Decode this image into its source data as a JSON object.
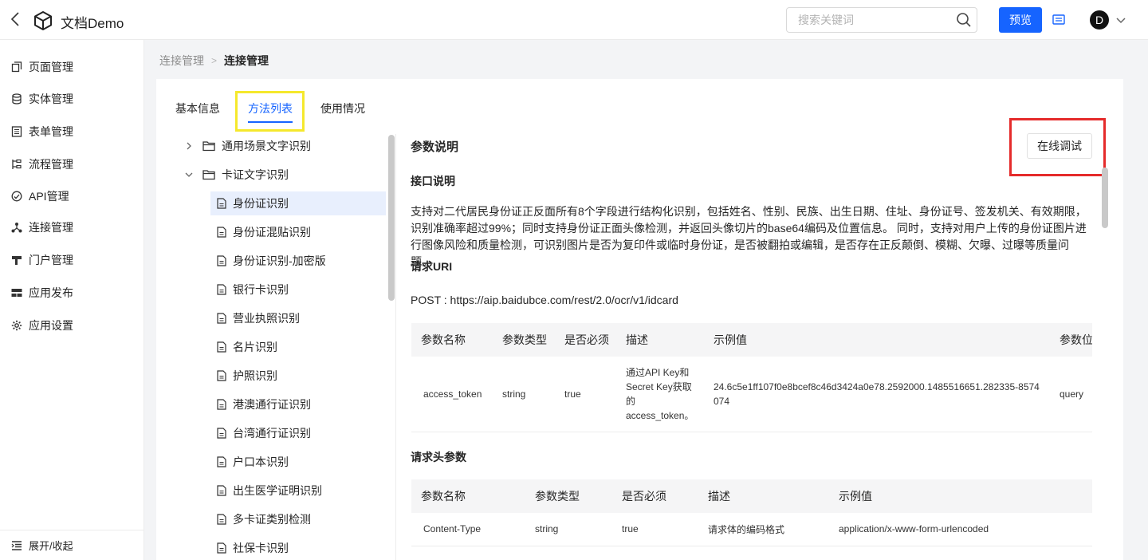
{
  "header": {
    "app_title": "文档Demo",
    "search_placeholder": "搜索关键词",
    "preview_label": "预览",
    "avatar_initial": "D"
  },
  "sidebar": {
    "items": [
      {
        "label": "页面管理",
        "icon": "pages-icon"
      },
      {
        "label": "实体管理",
        "icon": "database-icon"
      },
      {
        "label": "表单管理",
        "icon": "form-icon"
      },
      {
        "label": "流程管理",
        "icon": "flow-icon"
      },
      {
        "label": "API管理",
        "icon": "api-icon"
      },
      {
        "label": "连接管理",
        "icon": "connection-icon"
      },
      {
        "label": "门户管理",
        "icon": "portal-icon"
      },
      {
        "label": "应用发布",
        "icon": "publish-icon"
      },
      {
        "label": "应用设置",
        "icon": "gear-icon"
      }
    ],
    "footer_label": "展开/收起"
  },
  "breadcrumb": {
    "parent": "连接管理",
    "separator": ">",
    "current": "连接管理"
  },
  "tabs": [
    {
      "label": "基本信息",
      "active": false
    },
    {
      "label": "方法列表",
      "active": true
    },
    {
      "label": "使用情况",
      "active": false
    }
  ],
  "tree": {
    "folders": [
      {
        "label": "通用场景文字识别",
        "expanded": false
      },
      {
        "label": "卡证文字识别",
        "expanded": true
      }
    ],
    "items": [
      {
        "label": "身份证识别",
        "selected": true
      },
      {
        "label": "身份证混贴识别",
        "selected": false
      },
      {
        "label": "身份证识别-加密版",
        "selected": false
      },
      {
        "label": "银行卡识别",
        "selected": false
      },
      {
        "label": "营业执照识别",
        "selected": false
      },
      {
        "label": "名片识别",
        "selected": false
      },
      {
        "label": "护照识别",
        "selected": false
      },
      {
        "label": "港澳通行证识别",
        "selected": false
      },
      {
        "label": "台湾通行证识别",
        "selected": false
      },
      {
        "label": "户口本识别",
        "selected": false
      },
      {
        "label": "出生医学证明识别",
        "selected": false
      },
      {
        "label": "多卡证类别检测",
        "selected": false
      },
      {
        "label": "社保卡识别",
        "selected": false
      }
    ]
  },
  "doc": {
    "title": "参数说明",
    "debug_button": "在线调试",
    "interface_heading": "接口说明",
    "description_line1": "支持对二代居民身份证正反面所有8个字段进行结构化识别，包括姓名、性别、民族、出生日期、住址、身份证号、签发机关、有效期限，",
    "description_line2": "识别准确率超过99%；同时支持身份证正面头像检测，并返回头像切片的base64编码及位置信息。 同时，支持对用户上传的身份证图片进",
    "description_line3": "行图像风险和质量检测，可识别图片是否为复印件或临时身份证，是否被翻拍或编辑，是否存在正反颠倒、模糊、欠曝、过曝等质量问题。",
    "uri_heading": "请求URI",
    "post_line": "POST : https://aip.baidubce.com/rest/2.0/ocr/v1/idcard",
    "params_table": {
      "headers": [
        "参数名称",
        "参数类型",
        "是否必须",
        "描述",
        "示例值",
        "参数位"
      ],
      "rows": [
        {
          "name": "access_token",
          "type": "string",
          "required": "true",
          "desc": "通过API Key和Secret Key获取的access_token。",
          "example": "24.6c5e1ff107f0e8bcef8c46d3424a0e78.2592000.1485516651.282335-8574074",
          "position": "query"
        }
      ]
    },
    "headers_heading": "请求头参数",
    "header_table": {
      "headers": [
        "参数名称",
        "参数类型",
        "是否必须",
        "描述",
        "示例值"
      ],
      "rows": [
        {
          "name": "Content-Type",
          "type": "string",
          "required": "true",
          "desc": "请求体的编码格式",
          "example": "application/x-www-form-urlencoded"
        }
      ]
    }
  },
  "colors": {
    "primary": "#1664ff",
    "highlight_yellow": "#f5e82c",
    "highlight_red": "#e52b2b",
    "selected_bg": "#e8effd"
  }
}
